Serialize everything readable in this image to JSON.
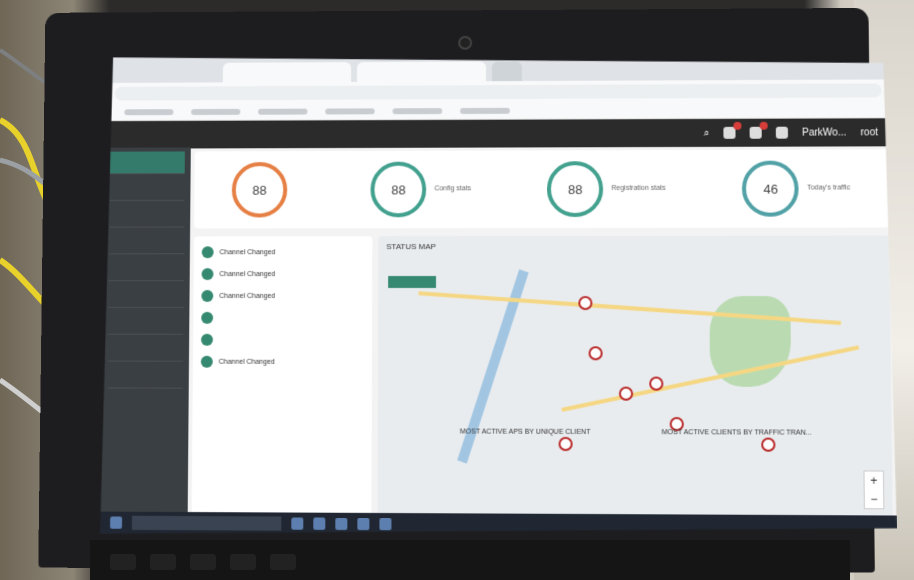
{
  "app": {
    "user": "root",
    "tab_title": "ParkWo..."
  },
  "stats": [
    {
      "value": "88",
      "name": "",
      "lines": []
    },
    {
      "value": "88",
      "name": "Config stats",
      "lines": []
    },
    {
      "value": "88",
      "name": "Registration stats",
      "lines": []
    },
    {
      "value": "46",
      "name": "Today's traffic",
      "lines": []
    }
  ],
  "events": [
    {
      "text": "Channel Changed"
    },
    {
      "text": "Channel Changed"
    },
    {
      "text": "Channel Changed"
    },
    {
      "text": ""
    },
    {
      "text": ""
    },
    {
      "text": "Channel Changed"
    }
  ],
  "map": {
    "title": "STATUS MAP"
  },
  "footer": {
    "left": "MOST ACTIVE APS BY UNIQUE CLIENT",
    "right": "MOST ACTIVE CLIENTS BY TRAFFIC TRAN..."
  },
  "colors": {
    "accent": "#2e8b6f",
    "gauge_orange": "#ef7d3c",
    "header_dark": "#2b2b2b"
  }
}
